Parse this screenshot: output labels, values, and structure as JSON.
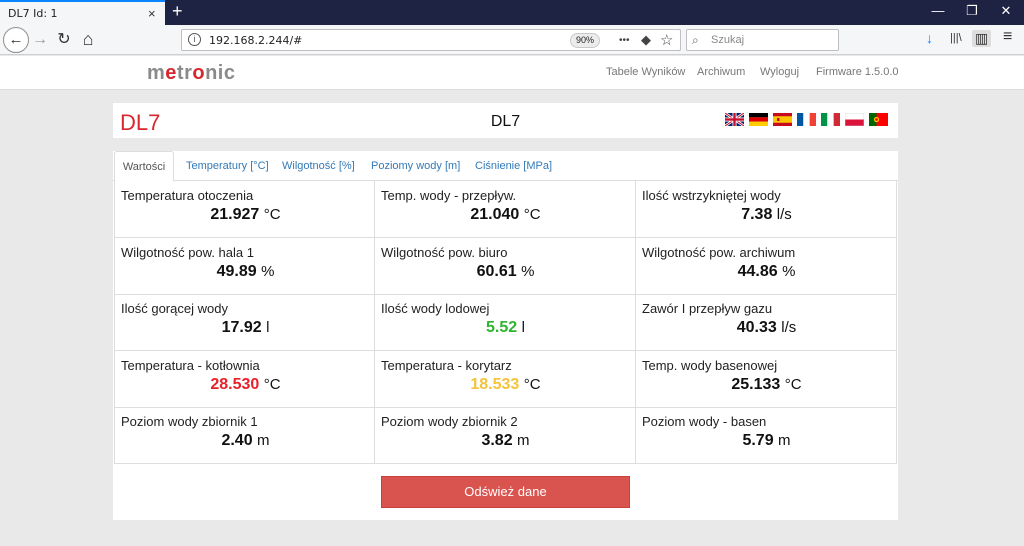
{
  "browser": {
    "tab_title": "DL7 Id: 1",
    "tab_close": "×",
    "new_tab": "+",
    "win_minimize": "—",
    "win_restore": "❐",
    "win_close": "✕",
    "back": "←",
    "forward": "→",
    "reload": "↻",
    "home": "⌂",
    "url": "192.168.2.244/#",
    "zoom": "90%",
    "page_actions": "•••",
    "pocket": "◆",
    "bookmark": "☆",
    "search_placeholder": "Szukaj",
    "download": "↓",
    "library": "|||\\",
    "sidebar": "▥",
    "menu": "≡"
  },
  "header": {
    "logo_pre": "m",
    "logo_accent": "e",
    "logo_mid": "tr",
    "logo_o": "o",
    "logo_post": "nic",
    "nav": [
      "Tabele Wyników",
      "Archiwum",
      "Wyloguj",
      "Firmware 1.5.0.0"
    ]
  },
  "title": {
    "left": "DL7",
    "center": "DL7"
  },
  "tabs": [
    "Wartości",
    "Temperatury [°C]",
    "Wilgotność [%]",
    "Poziomy wody [m]",
    "Ciśnienie [MPa]"
  ],
  "cells": [
    {
      "label": "Temperatura otoczenia",
      "value": "21.927",
      "unit": "°C",
      "color": "#111111"
    },
    {
      "label": "Temp. wody - przepływ.",
      "value": "21.040",
      "unit": "°C",
      "color": "#111111"
    },
    {
      "label": "Ilość wstrzykniętej wody",
      "value": "7.38",
      "unit": "l/s",
      "color": "#111111"
    },
    {
      "label": "Wilgotność pow. hala 1",
      "value": "49.89",
      "unit": "%",
      "color": "#111111"
    },
    {
      "label": "Wilgotność pow. biuro",
      "value": "60.61",
      "unit": "%",
      "color": "#111111"
    },
    {
      "label": "Wilgotność pow. archiwum",
      "value": "44.86",
      "unit": "%",
      "color": "#111111"
    },
    {
      "label": "Ilość gorącej wody",
      "value": "17.92",
      "unit": "l",
      "color": "#111111"
    },
    {
      "label": "Ilość wody lodowej",
      "value": "5.52",
      "unit": "l",
      "color": "#2db52d"
    },
    {
      "label": "Zawór I przepływ gazu",
      "value": "40.33",
      "unit": "l/s",
      "color": "#111111"
    },
    {
      "label": "Temperatura - kotłownia",
      "value": "28.530",
      "unit": "°C",
      "color": "#e8202a"
    },
    {
      "label": "Temperatura - korytarz",
      "value": "18.533",
      "unit": "°C",
      "color": "#f3c33a"
    },
    {
      "label": "Temp. wody basenowej",
      "value": "25.133",
      "unit": "°C",
      "color": "#111111"
    },
    {
      "label": "Poziom wody zbiornik 1",
      "value": "2.40",
      "unit": "m",
      "color": "#111111"
    },
    {
      "label": "Poziom wody zbiornik 2",
      "value": "3.82",
      "unit": "m",
      "color": "#111111"
    },
    {
      "label": "Poziom wody - basen",
      "value": "5.79",
      "unit": "m",
      "color": "#111111"
    }
  ],
  "refresh_label": "Odśwież dane",
  "colors": {
    "brand_red": "#d7282f",
    "button_red": "#d9534f",
    "link_blue": "#337ab7"
  }
}
